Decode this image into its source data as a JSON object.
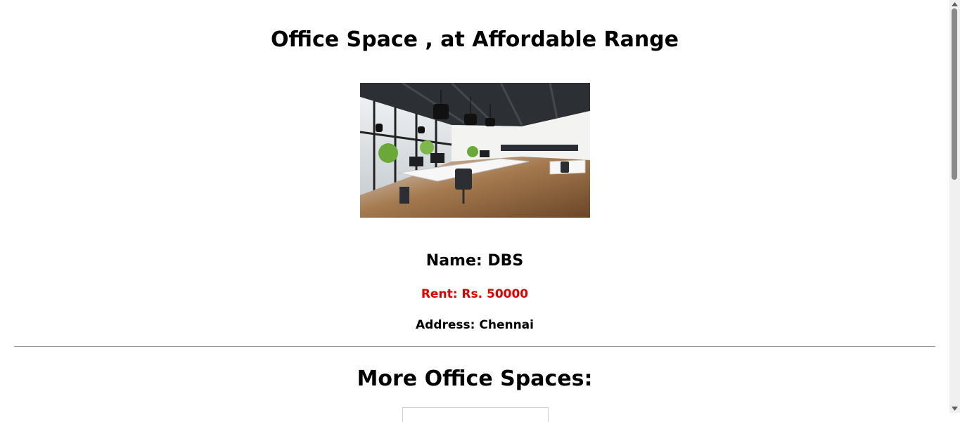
{
  "page": {
    "title": "Office Space , at Affordable Range",
    "image_alt": "Office interior"
  },
  "office": {
    "name_label": "Name: DBS",
    "rent_label": "Rent: Rs. 50000",
    "address_label": "Address: Chennai",
    "rent_color": "#e00000"
  },
  "more_section": {
    "heading": "More Office Spaces:"
  },
  "icons": {
    "scroll_up": "triangle-up-icon",
    "scroll_down": "triangle-down-icon"
  }
}
